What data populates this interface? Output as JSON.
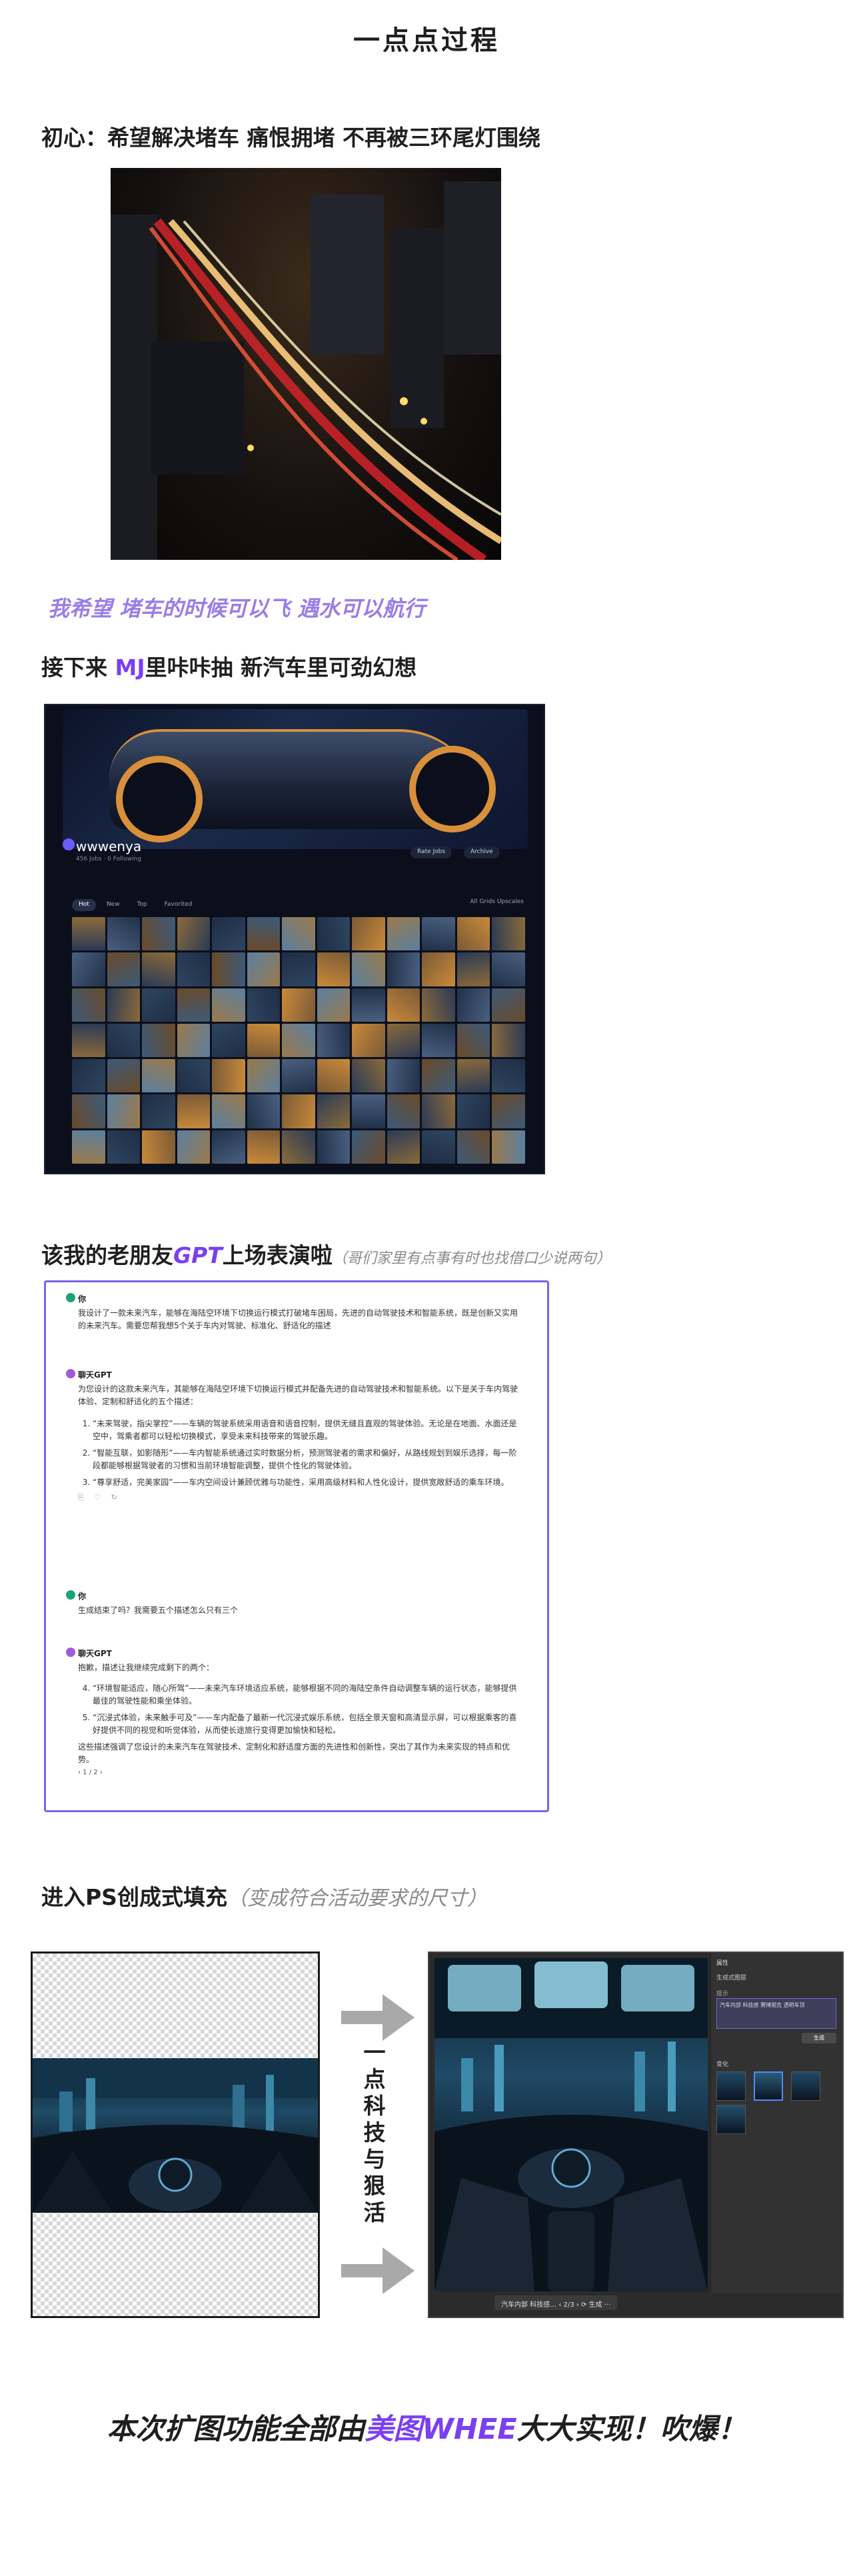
{
  "page": {
    "title": "一点点过程",
    "section1": "初心：希望解决堵车 痛恨拥堵 不再被三环尾灯围绕",
    "wish": "我希望 堵车的时候可以飞 遇水可以航行",
    "section2_pre": "接下来 ",
    "section2_brand": "MJ",
    "section2_post": "里咔咔抽 新汽车里可劲幻想",
    "section3_pre": "该我的老朋友",
    "section3_brand": "GPT",
    "section3_post": "上场表演啦",
    "section3_note": "（哥们家里有点事有时也找借口少说两句）",
    "section4_main": "进入PS创成式填充",
    "section4_note": "（变成符合活动要求的尺寸）",
    "vertical_text": "一点科技与狠活",
    "final_pre": "本次扩图功能全部由",
    "final_brand": "美图WHEE",
    "final_post": "大大实现！吹爆！"
  },
  "mj": {
    "username": "wwwenya",
    "subtitle": "456 Jobs · 0 Following",
    "pill1": "Rate Jobs",
    "pill2": "Archive",
    "tabs": [
      "Hot",
      "New",
      "Top",
      "Favorited"
    ],
    "right_label": "All  Grids  Upscales"
  },
  "chat": {
    "you_label": "你",
    "gpt_label": "聊天GPT",
    "q1": "我设计了一款未来汽车，能够在海陆空环境下切换运行模式打破堵车困局，先进的自动驾驶技术和智能系统，既是创新又实用的未来汽车。需要您帮我想5个关于车内对驾驶、标准化、舒适化的描述",
    "a1_intro": "为您设计的这款未来汽车，其能够在海陆空环境下切换运行模式并配备先进的自动驾驶技术和智能系统。以下是关于车内驾驶体验、定制和舒适化的五个描述：",
    "a1_items": [
      "“未来驾驶，指尖掌控”——车辆的驾驶系统采用语音和语音控制，提供无缝且直观的驾驶体验。无论是在地面、水面还是空中，驾乘者都可以轻松切换模式，享受未来科技带来的驾驶乐趣。",
      "“智能互联，如影随形”——车内智能系统通过实时数据分析，预测驾驶者的需求和偏好，从路线规划到娱乐选择，每一阶段都能够根据驾驶者的习惯和当前环境智能调整，提供个性化的驾驶体验。",
      "“尊享舒适，完美家园”——车内空间设计兼顾优雅与功能性，采用高级材料和人性化设计，提供宽敞舒适的乘车环境。"
    ],
    "actions": "⎘ ♡ ↻",
    "q2": "生成结束了吗？我需要五个描述怎么只有三个",
    "a2_intro": "抱歉，描述让我继续完成剩下的两个：",
    "a2_items": [
      "“环境智能适应，随心所驾”——未来汽车环境适应系统，能够根据不同的海陆空条件自动调整车辆的运行状态，能够提供最佳的驾驶性能和乘坐体验。",
      "“沉浸式体验，未来触手可及”——车内配备了最新一代沉浸式娱乐系统，包括全景天窗和高清显示屏，可以根据乘客的喜好提供不同的视觉和听觉体验，从而使长途旅行变得更加愉快和轻松。"
    ],
    "a2_outro": "这些描述强调了您设计的未来汽车在驾驶技术、定制化和舒适度方面的先进性和创新性，突出了其作为未来实现的特点和优势。",
    "pager": "‹ 1 / 2 ›"
  },
  "ps": {
    "panel_title": "属性",
    "panel_layer": "生成式图层",
    "panel_prompt_label": "提示",
    "panel_prompt": "汽车内部 科技感 赛博朋克 透明车顶",
    "panel_btn": "生成",
    "panel_variants": "变化",
    "bottom_bar": "汽车内部 科技感…  ‹  2/3  ›  ⟳ 生成  ···"
  },
  "colors": {
    "accent": "#7b3ff2",
    "lavender": "#9a7de6",
    "chat_border": "#7d62e8",
    "arrow": "#a9a9a9"
  },
  "icons": {
    "gpt_avatar": "openai-avatar-icon",
    "user_avatar": "user-avatar-icon",
    "arrow": "right-arrow-icon"
  }
}
